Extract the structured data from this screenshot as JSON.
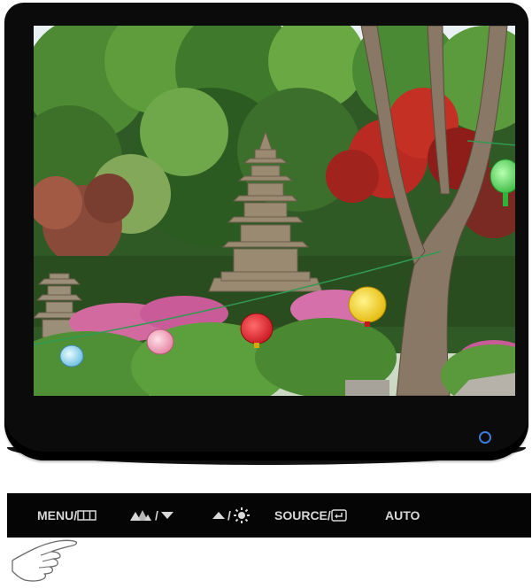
{
  "controls": {
    "menu_label": "MENU/",
    "brightness_sep": "/",
    "up_sep": "/",
    "source_label": "SOURCE/",
    "auto_label": "AUTO"
  },
  "icons": {
    "menu": "menu-grid-icon",
    "magic": "magic-bright-icon",
    "down": "down-arrow-icon",
    "up": "up-arrow-icon",
    "brightness": "brightness-sun-icon",
    "source": "source-enter-icon",
    "power": "power-led-icon",
    "hand": "pointing-hand-icon"
  },
  "colors": {
    "bezel": "#0b0b0b",
    "control_bar": "#050505",
    "control_text": "#d8d8d8",
    "power_led": "#3c7bd9"
  }
}
